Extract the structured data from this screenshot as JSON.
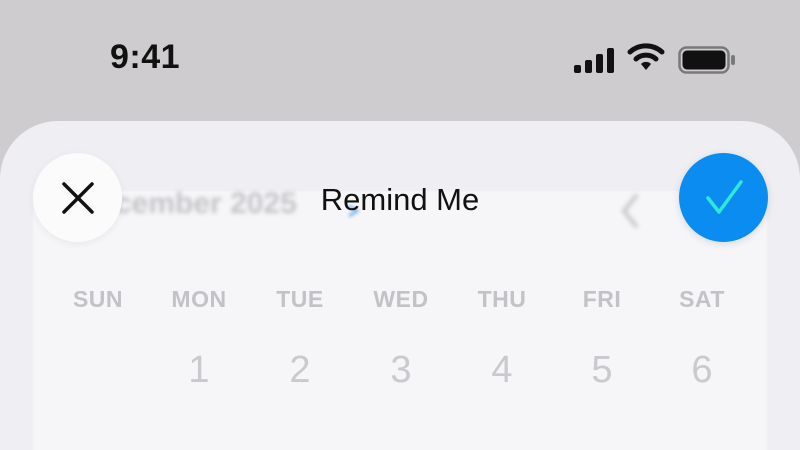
{
  "status_bar": {
    "time": "9:41",
    "icons": [
      "cellular-signal-icon",
      "wifi-icon",
      "battery-icon"
    ]
  },
  "sheet": {
    "title": "Remind Me",
    "close_icon": "close-icon",
    "confirm_icon": "checkmark-icon",
    "accent_color": "#0a8cf0",
    "calendar": {
      "month_label": "cember 2025",
      "weekdays": [
        "SUN",
        "MON",
        "TUE",
        "WED",
        "THU",
        "FRI",
        "SAT"
      ],
      "first_row_dates": [
        "",
        "1",
        "2",
        "3",
        "4",
        "5",
        "6"
      ]
    }
  }
}
